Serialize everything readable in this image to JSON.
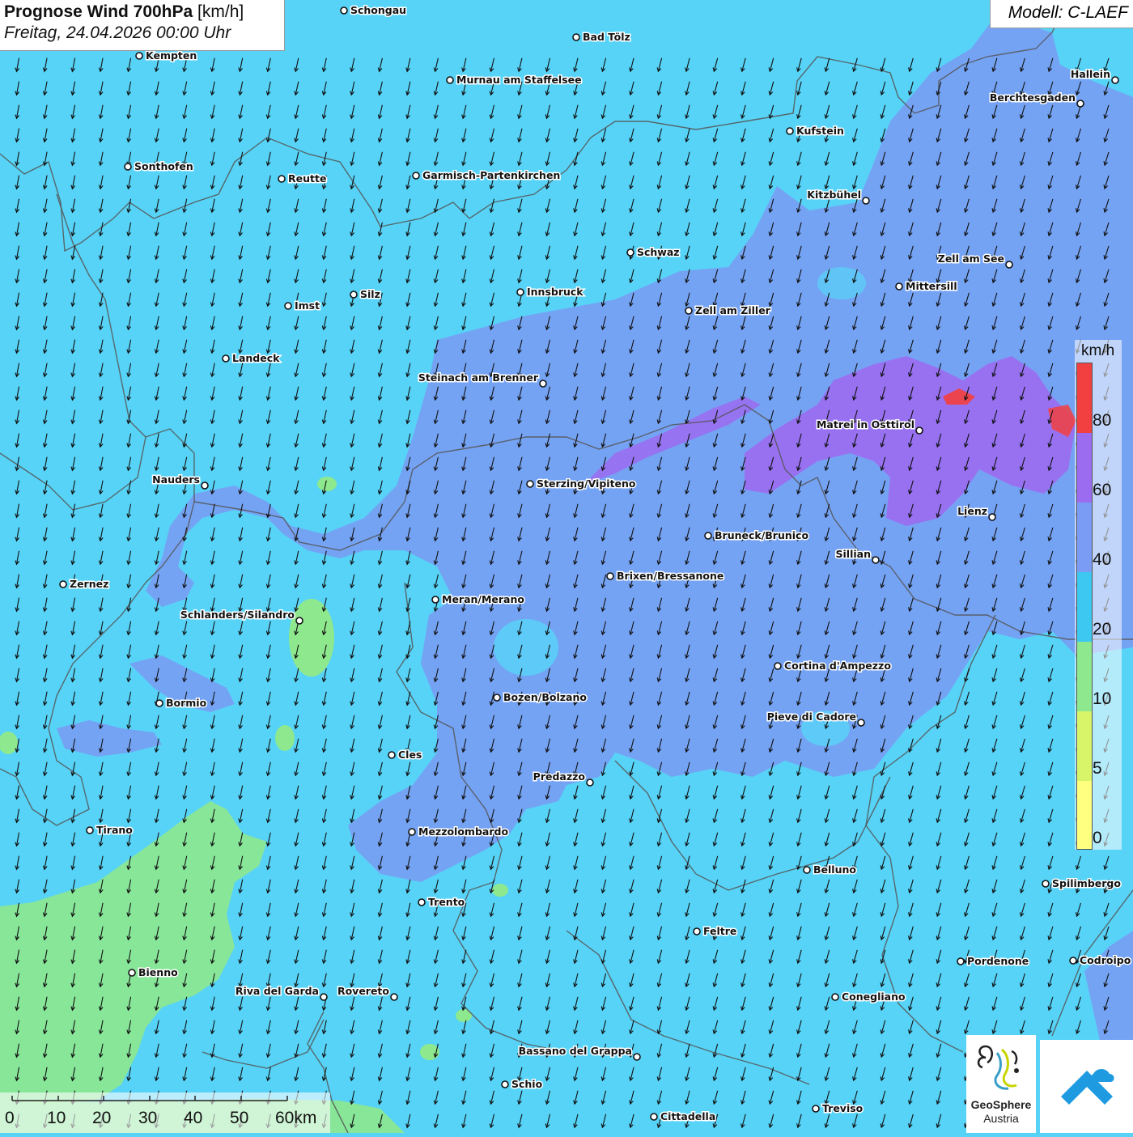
{
  "header": {
    "title_bold": "Prognose Wind 700hPa",
    "title_unit": "[km/h]",
    "datetime": "Freitag, 24.04.2026 00:00 Uhr",
    "model": "Modell: C-LAEF"
  },
  "colors": {
    "ocean_base": "#57d3f7",
    "level_0": "#ffff80",
    "level_5": "#d8f56a",
    "level_10": "#8ee88e",
    "level_20": "#3cc8f0",
    "level_40": "#7a9cf4",
    "level_60": "#9b6cf0",
    "level_80": "#f24040",
    "border": "#555555",
    "arrow": "#111111"
  },
  "legend": {
    "unit": "km/h",
    "ticks": [
      "80",
      "60",
      "40",
      "20",
      "10",
      "5",
      "0"
    ]
  },
  "scale": {
    "ticks": [
      "0",
      "10",
      "20",
      "30",
      "40",
      "50",
      "60km"
    ]
  },
  "wind": {
    "prevailing_direction": "north to south, slightly from north-east"
  },
  "cities": [
    {
      "name": "Schongau",
      "label_side": "right"
    },
    {
      "name": "Bad Tölz",
      "label_side": "right"
    },
    {
      "name": "Kempten",
      "label_side": "right"
    },
    {
      "name": "Murnau am Staffelsee",
      "label_side": "right"
    },
    {
      "name": "Hallein",
      "label_side": "left"
    },
    {
      "name": "Berchtesgaden",
      "label_side": "left"
    },
    {
      "name": "Kufstein",
      "label_side": "right"
    },
    {
      "name": "Sonthofen",
      "label_side": "right"
    },
    {
      "name": "Reutte",
      "label_side": "right"
    },
    {
      "name": "Garmisch-Partenkirchen",
      "label_side": "right"
    },
    {
      "name": "Kitzbühel",
      "label_side": "left"
    },
    {
      "name": "Schwaz",
      "label_side": "right"
    },
    {
      "name": "Zell am See",
      "label_side": "left"
    },
    {
      "name": "Mittersill",
      "label_side": "right"
    },
    {
      "name": "Innsbruck",
      "label_side": "right"
    },
    {
      "name": "Silz",
      "label_side": "right"
    },
    {
      "name": "Imst",
      "label_side": "right"
    },
    {
      "name": "Zell am Ziller",
      "label_side": "right"
    },
    {
      "name": "Landeck",
      "label_side": "right"
    },
    {
      "name": "Steinach am Brenner",
      "label_side": "left"
    },
    {
      "name": "Matrei in Osttirol",
      "label_side": "left"
    },
    {
      "name": "Nauders",
      "label_side": "left"
    },
    {
      "name": "Sterzing/Vipiteno",
      "label_side": "right"
    },
    {
      "name": "Lienz",
      "label_side": "left"
    },
    {
      "name": "Bruneck/Brunico",
      "label_side": "right"
    },
    {
      "name": "Sillian",
      "label_side": "left"
    },
    {
      "name": "Zernez",
      "label_side": "right"
    },
    {
      "name": "Brixen/Bressanone",
      "label_side": "right"
    },
    {
      "name": "Meran/Merano",
      "label_side": "right"
    },
    {
      "name": "Schlanders/Silandro",
      "label_side": "left"
    },
    {
      "name": "Cortina d'Ampezzo",
      "label_side": "right"
    },
    {
      "name": "Bozen/Bolzano",
      "label_side": "right"
    },
    {
      "name": "Bormio",
      "label_side": "right"
    },
    {
      "name": "Pieve di Cadore",
      "label_side": "left"
    },
    {
      "name": "Cles",
      "label_side": "right"
    },
    {
      "name": "Predazzo",
      "label_side": "left"
    },
    {
      "name": "Tirano",
      "label_side": "right"
    },
    {
      "name": "Mezzolombardo",
      "label_side": "right"
    },
    {
      "name": "Belluno",
      "label_side": "right"
    },
    {
      "name": "Spilimbergo",
      "label_side": "right"
    },
    {
      "name": "Trento",
      "label_side": "right"
    },
    {
      "name": "Feltre",
      "label_side": "right"
    },
    {
      "name": "Pordenone",
      "label_side": "right"
    },
    {
      "name": "Codroipo",
      "label_side": "right"
    },
    {
      "name": "Bienno",
      "label_side": "right"
    },
    {
      "name": "Riva del Garda",
      "label_side": "left"
    },
    {
      "name": "Rovereto",
      "label_side": "left"
    },
    {
      "name": "Conegliano",
      "label_side": "right"
    },
    {
      "name": "Bassano del Grappa",
      "label_side": "left"
    },
    {
      "name": "Schio",
      "label_side": "right"
    },
    {
      "name": "Treviso",
      "label_side": "right"
    },
    {
      "name": "Cittadella",
      "label_side": "right"
    }
  ],
  "logos": {
    "geosphere_name": "GeoSphere",
    "geosphere_sub": "Austria"
  }
}
